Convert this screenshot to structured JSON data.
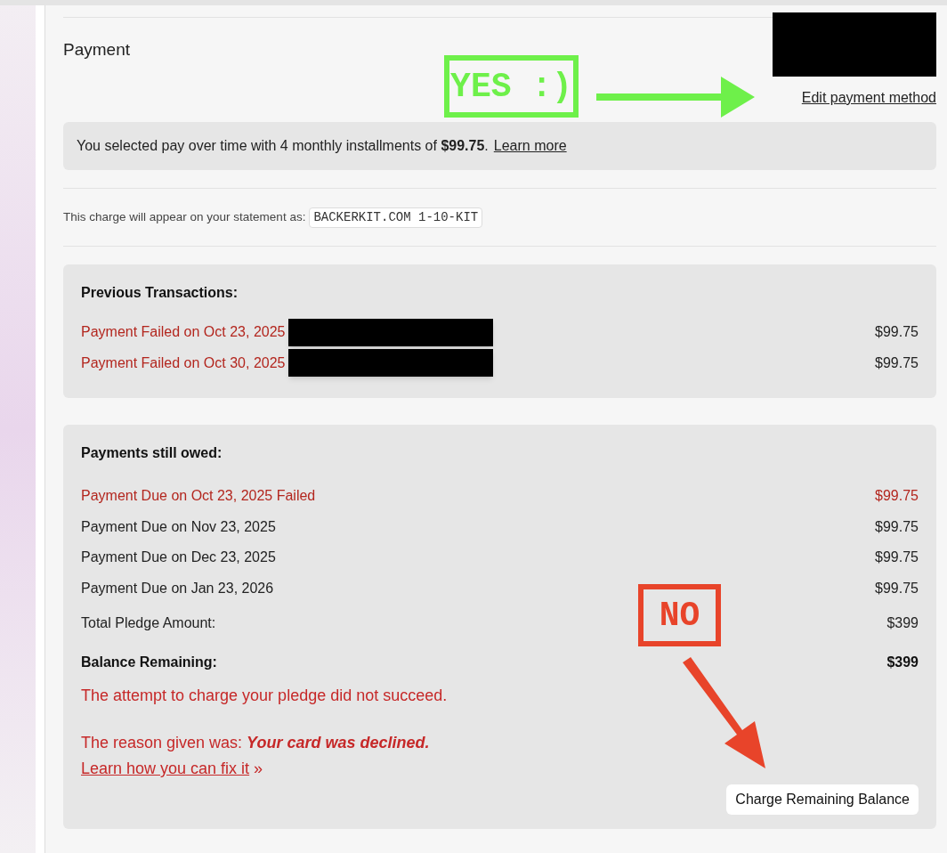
{
  "section_title": "Payment",
  "edit_link": "Edit payment method",
  "installment_notice": {
    "text": "You selected pay over time with 4 monthly installments of **$99.75**.",
    "link": "Learn more"
  },
  "statement": {
    "label": "This charge will appear on your statement as:",
    "descriptor": "BACKERKIT.COM 1-10-KIT"
  },
  "previous_transactions": {
    "title": "Previous Transactions:",
    "rows": [
      {
        "label": "Payment Failed on Oct 23, 2025",
        "amount": "$99.75",
        "failed": true,
        "redacted": true
      },
      {
        "label": "Payment Failed on Oct 30, 2025",
        "amount": "$99.75",
        "failed": true,
        "redacted": true
      }
    ]
  },
  "payments_owed": {
    "title": "Payments still owed:",
    "rows": [
      {
        "label": "Payment Due on Oct 23, 2025 Failed",
        "amount": "$99.75",
        "failed": true
      },
      {
        "label": "Payment Due on Nov 23, 2025",
        "amount": "$99.75",
        "failed": false
      },
      {
        "label": "Payment Due on Dec 23, 2025",
        "amount": "$99.75",
        "failed": false
      },
      {
        "label": "Payment Due on Jan 23, 2026",
        "amount": "$99.75",
        "failed": false
      }
    ],
    "totals": [
      {
        "label": "Total Pledge Amount:",
        "amount": "$399",
        "bold": false
      },
      {
        "label": "Balance Remaining:",
        "amount": "$399",
        "bold": true
      }
    ],
    "error": "The attempt to charge your pledge did not succeed.",
    "reason": "The reason given was: **Your card was declined.**",
    "fix_link": "Learn how you can fix it",
    "fix_suffix": "»",
    "button": "Charge Remaining Balance"
  },
  "annotations": [
    {
      "text": "YES :)",
      "color": "#6ef04a"
    },
    {
      "text": "NO",
      "color": "#e8442a"
    }
  ]
}
